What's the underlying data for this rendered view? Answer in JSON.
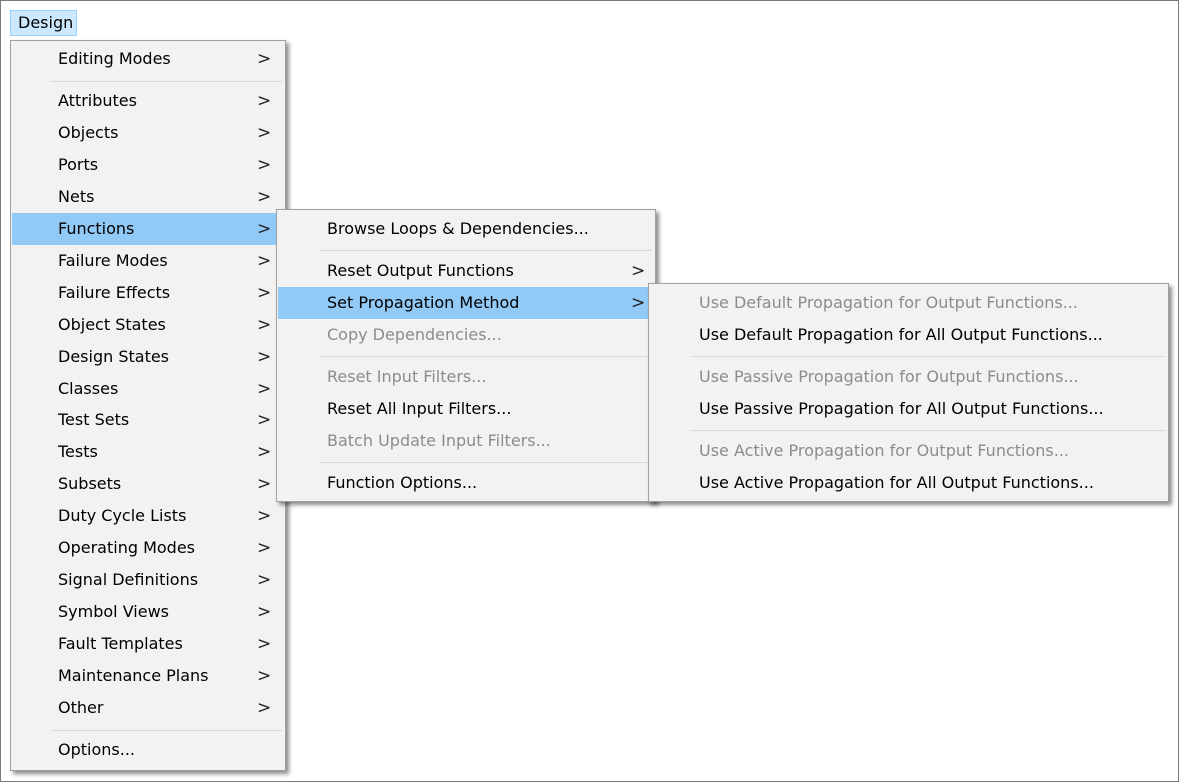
{
  "menubar": {
    "design_label": "Design"
  },
  "design_menu": {
    "items": [
      {
        "label": "Editing Modes"
      },
      {
        "label": "Attributes"
      },
      {
        "label": "Objects"
      },
      {
        "label": "Ports"
      },
      {
        "label": "Nets"
      },
      {
        "label": "Functions"
      },
      {
        "label": "Failure Modes"
      },
      {
        "label": "Failure Effects"
      },
      {
        "label": "Object States"
      },
      {
        "label": "Design States"
      },
      {
        "label": "Classes"
      },
      {
        "label": "Test Sets"
      },
      {
        "label": "Tests"
      },
      {
        "label": "Subsets"
      },
      {
        "label": "Duty Cycle Lists"
      },
      {
        "label": "Operating Modes"
      },
      {
        "label": "Signal Definitions"
      },
      {
        "label": "Symbol Views"
      },
      {
        "label": "Fault Templates"
      },
      {
        "label": "Maintenance Plans"
      },
      {
        "label": "Other"
      },
      {
        "label": "Options..."
      }
    ],
    "submenu_arrow": ">"
  },
  "functions_menu": {
    "items": [
      {
        "label": "Browse Loops & Dependencies..."
      },
      {
        "label": "Reset Output Functions"
      },
      {
        "label": "Set Propagation Method"
      },
      {
        "label": "Copy Dependencies..."
      },
      {
        "label": "Reset Input Filters..."
      },
      {
        "label": "Reset All Input Filters..."
      },
      {
        "label": "Batch Update Input Filters..."
      },
      {
        "label": "Function Options..."
      }
    ]
  },
  "propagation_menu": {
    "items": [
      {
        "label": "Use Default Propagation for Output Functions..."
      },
      {
        "label": "Use Default Propagation for All Output Functions..."
      },
      {
        "label": "Use Passive Propagation for Output Functions..."
      },
      {
        "label": "Use Passive Propagation for All Output Functions..."
      },
      {
        "label": "Use Active Propagation for Output Functions..."
      },
      {
        "label": "Use Active Propagation for All Output Functions..."
      }
    ]
  },
  "colors": {
    "highlight": "#91c9f7",
    "disabled_text": "#8c8c8c",
    "menu_background": "#f2f2f2",
    "menubar_active": "#cce8ff"
  }
}
